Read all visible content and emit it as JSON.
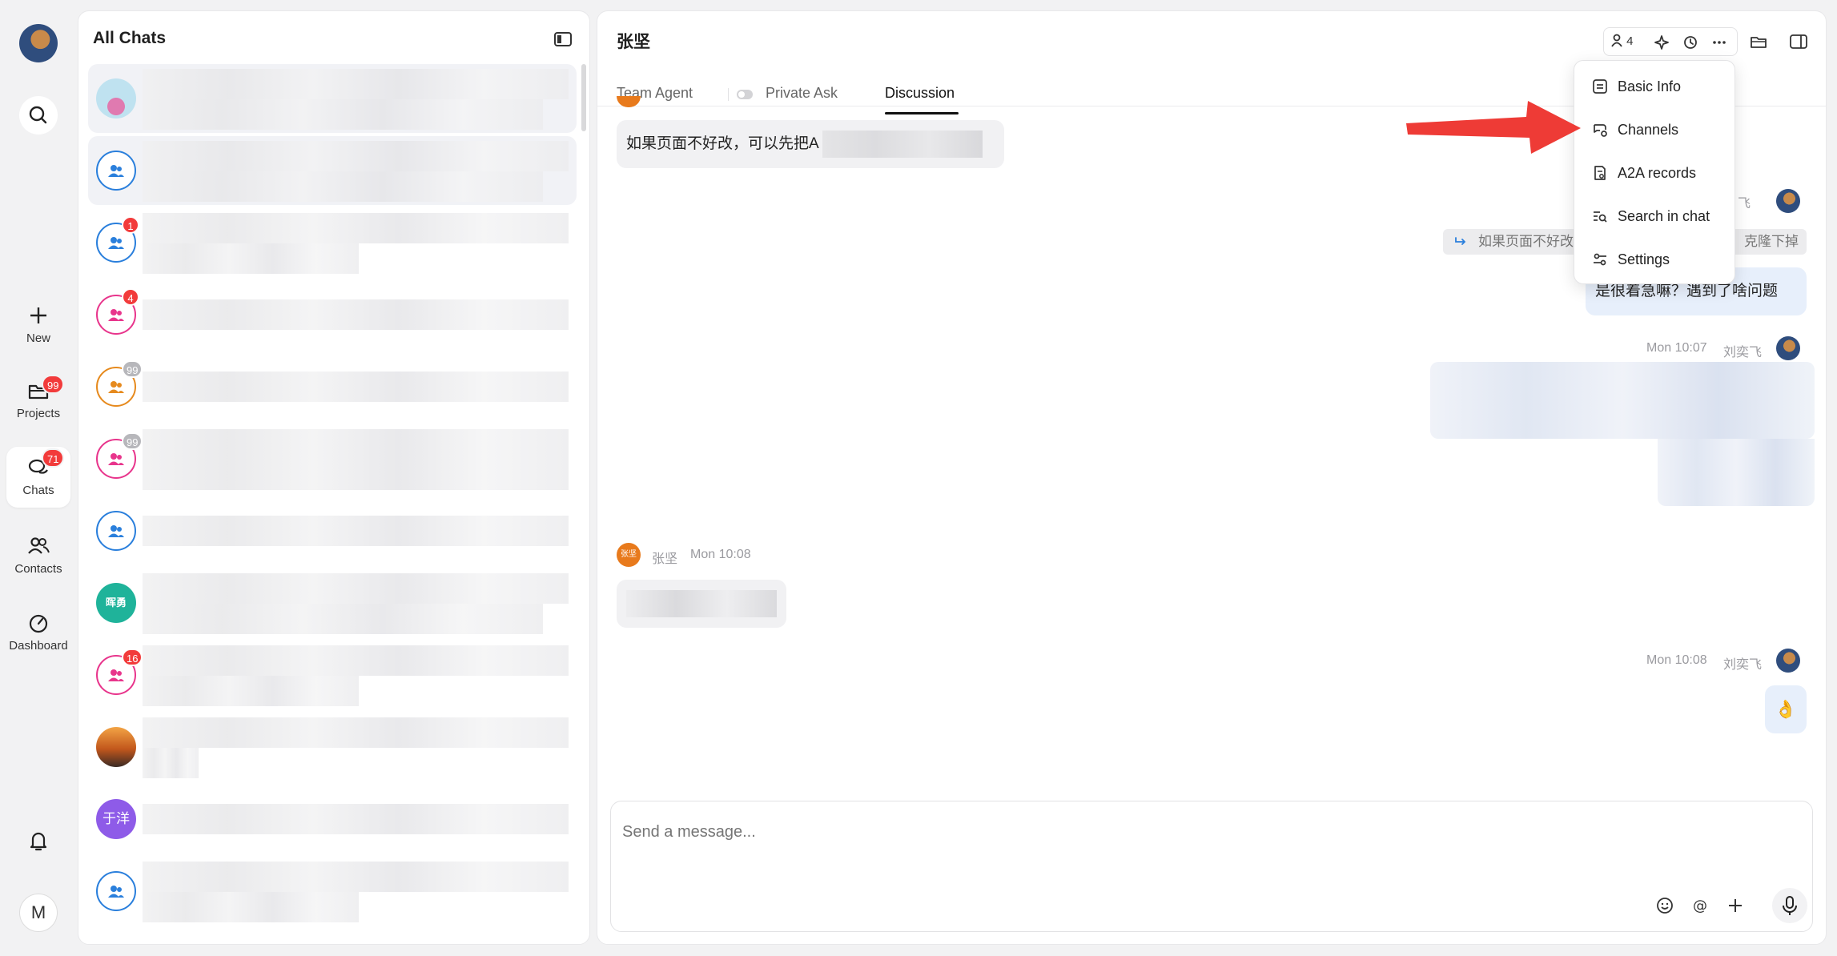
{
  "rail": {
    "new_label": "New",
    "projects_label": "Projects",
    "projects_badge": "99",
    "chats_label": "Chats",
    "chats_badge": "71",
    "contacts_label": "Contacts",
    "dashboard_label": "Dashboard",
    "me_initial": "M"
  },
  "chat_list": {
    "title": "All Chats",
    "rows": [
      {
        "badge": ""
      },
      {
        "badge": ""
      },
      {
        "badge": "1"
      },
      {
        "badge": "4"
      },
      {
        "badge": "99"
      },
      {
        "badge": "99"
      },
      {
        "badge": ""
      },
      {
        "avatar_text": "晖勇",
        "badge": ""
      },
      {
        "badge": "16"
      },
      {
        "badge": ""
      },
      {
        "avatar_text": "于洋",
        "badge": ""
      },
      {
        "badge": ""
      }
    ]
  },
  "conversation": {
    "title": "张坚",
    "member_count": "4",
    "tabs": {
      "team_agent": "Team Agent",
      "private_ask": "Private Ask",
      "discussion": "Discussion"
    },
    "messages": {
      "m1_text": "如果页面不好改，可以先把A",
      "m2_sender_partial": "刘奕飞",
      "m2_sender_suffix": "飞",
      "m2_quote": "如果页面不好改",
      "m2_quote_tail": "克隆下掉",
      "m2_text": "是很着急嘛？遇到了啥问题",
      "m3_time": "Mon 10:07",
      "m3_sender": "刘奕飞",
      "m4_avatar": "张坚",
      "m4_sender": "张坚",
      "m4_time": "Mon 10:08",
      "m5_time": "Mon 10:08",
      "m5_sender": "刘奕飞",
      "m5_emoji": "👌"
    },
    "composer_placeholder": "Send a message..."
  },
  "menu": {
    "items": [
      "Basic Info",
      "Channels",
      "A2A records",
      "Search in chat",
      "Settings"
    ]
  },
  "colors": {
    "badge_red": "#f23b3b",
    "blue_group": "#2a7fdc",
    "pink_group": "#e8358c",
    "orange_group": "#e68a1e",
    "annotation_arrow": "#ee3b36"
  }
}
